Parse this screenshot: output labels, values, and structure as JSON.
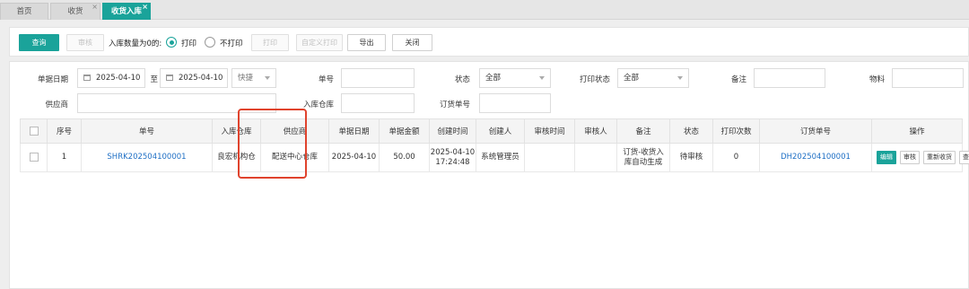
{
  "tabs": [
    {
      "label": "首页",
      "closable": false,
      "active": false
    },
    {
      "label": "收货",
      "closable": true,
      "active": false
    },
    {
      "label": "收货入库",
      "closable": true,
      "active": true
    }
  ],
  "toolbar": {
    "query": "查询",
    "audit": "审核",
    "zero_qty_label": "入库数量为0的:",
    "print_option": "打印",
    "no_print_option": "不打印",
    "print": "打印",
    "custom_print": "自定义打印",
    "export": "导出",
    "close": "关闭",
    "selected_radio": "打印"
  },
  "filters": {
    "doc_date_label": "单据日期",
    "date_from": "2025-04-10",
    "to_label": "至",
    "date_to": "2025-04-10",
    "quick_select": "快捷",
    "doc_no_label": "单号",
    "doc_no_value": "",
    "status_label": "状态",
    "status_value": "全部",
    "print_status_label": "打印状态",
    "print_status_value": "全部",
    "remark_label": "备注",
    "remark_value": "",
    "material_label": "物料",
    "material_value": "",
    "supplier_label": "供应商",
    "supplier_value": "",
    "warehouse_label": "入库仓库",
    "warehouse_value": "",
    "order_no_label": "订货单号",
    "order_no_value": ""
  },
  "table": {
    "columns": [
      "序号",
      "单号",
      "入库仓库",
      "供应商",
      "单据日期",
      "单据金额",
      "创建时间",
      "创建人",
      "审核时间",
      "审核人",
      "备注",
      "状态",
      "打印次数",
      "订货单号",
      "操作"
    ],
    "rows": [
      {
        "index": "1",
        "doc_no": "SHRK202504100001",
        "warehouse": "良宏机构仓",
        "supplier": "配送中心仓库",
        "doc_date": "2025-04-10",
        "amount": "50.00",
        "created_date": "2025-04-10",
        "created_time": "17:24:48",
        "creator": "系统管理员",
        "audit_time": "",
        "auditor": "",
        "remark_line1": "订货-收货入",
        "remark_line2": "库自动生成",
        "status": "待审核",
        "print_count": "0",
        "order_no": "DH202504100001",
        "actions": [
          "编辑",
          "审核",
          "重新收货",
          "查看"
        ]
      }
    ]
  },
  "colors": {
    "accent": "#1aa39a",
    "link": "#1e6fc5",
    "highlight_box": "#e0432d"
  }
}
